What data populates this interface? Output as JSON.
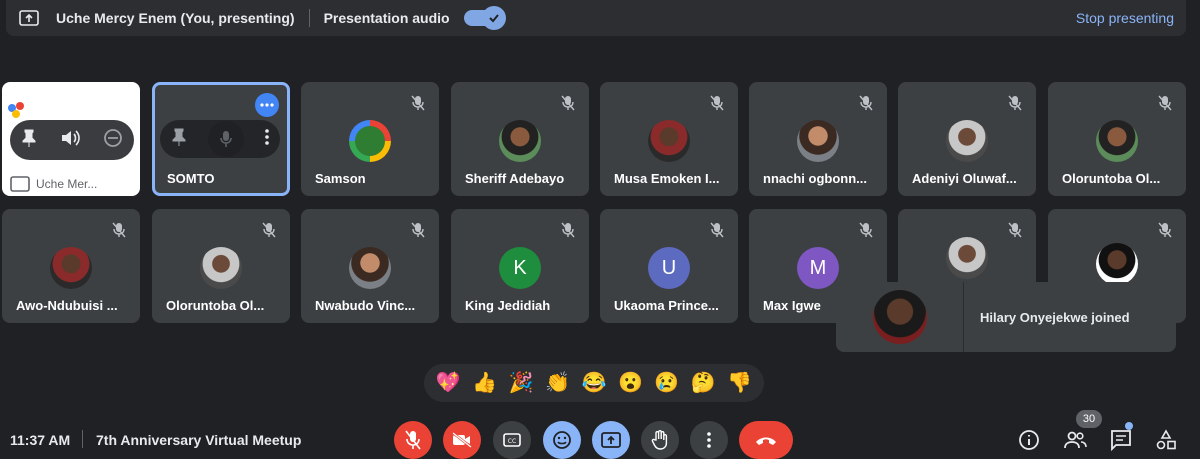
{
  "presenting": {
    "name": "Uche Mercy Enem (You, presenting)",
    "audio_label": "Presentation audio",
    "stop_label": "Stop presenting"
  },
  "self_tile": {
    "label": "Uche Mer..."
  },
  "tiles": [
    {
      "name": "SOMTO"
    },
    {
      "name": "Samson"
    },
    {
      "name": "Sheriff Adebayo"
    },
    {
      "name": "Musa Emoken I..."
    },
    {
      "name": "nnachi ogbonn..."
    },
    {
      "name": "Adeniyi Oluwaf..."
    },
    {
      "name": "Oloruntoba Ol..."
    },
    {
      "name": "Awo-Ndubuisi ..."
    },
    {
      "name": "Oloruntoba Ol..."
    },
    {
      "name": "Nwabudo Vinc..."
    },
    {
      "name": "King Jedidiah",
      "initial": "K"
    },
    {
      "name": "Ukaoma Prince...",
      "initial": "U"
    },
    {
      "name": "Max Igwe",
      "initial": "M"
    }
  ],
  "toast": {
    "text": "Hilary Onyejekwe joined"
  },
  "reactions": [
    "💖",
    "👍",
    "🎉",
    "👏",
    "😂",
    "😮",
    "😢",
    "🤔",
    "👎"
  ],
  "meeting": {
    "time": "11:37 AM",
    "name": "7th Anniversary Virtual Meetup"
  },
  "people_count": "30",
  "colors": {
    "accent": "#8ab4f8",
    "danger": "#ea4335",
    "tile": "#3c4043",
    "background": "#202124"
  }
}
